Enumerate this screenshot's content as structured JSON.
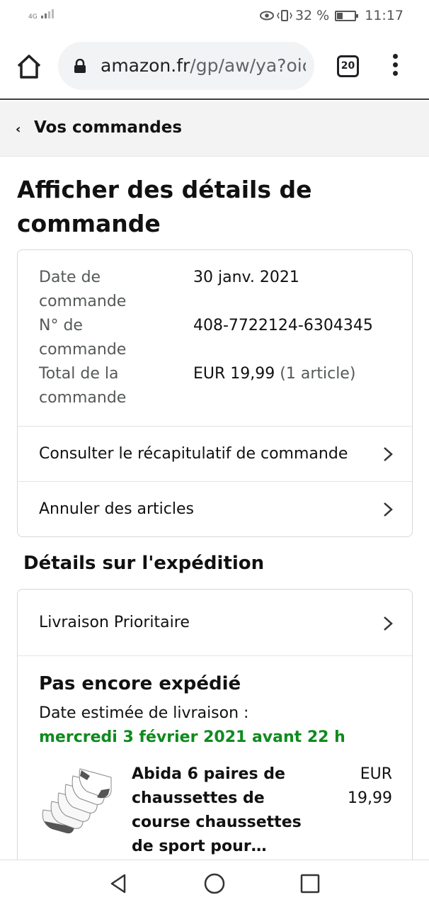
{
  "status_bar": {
    "network": "4G",
    "battery_percent": "32 %",
    "battery_level": 0.32,
    "time": "11:17"
  },
  "browser": {
    "url_host": "amazon.fr",
    "url_path": "/gp/aw/ya?oic",
    "tab_count": "20"
  },
  "breadcrumb": {
    "label": "Vos commandes"
  },
  "page_title": "Afficher des détails de commande",
  "order": {
    "date_label": "Date de commande",
    "date_value": "30 janv. 2021",
    "number_label": "N° de commande",
    "number_value": "408-7722124-6304345",
    "total_label": "Total de la commande",
    "total_value": "EUR 19,99",
    "total_items": "(1 article)",
    "summary_link": "Consulter le récapitulatif de commande",
    "cancel_link": "Annuler des articles"
  },
  "shipment": {
    "section_title": "Détails sur l'expédition",
    "delivery_type": "Livraison Prioritaire",
    "status": "Pas encore expédié",
    "estimate_label": "Date estimée de livraison :",
    "estimate_date": "mercredi 3 février 2021 avant 22 h",
    "product_title": "Abida 6 paires de chaussettes de course chaussettes de sport pour…",
    "price_currency": "EUR",
    "price_amount": "19,99"
  },
  "colors": {
    "delivery_green": "#0f8a1f",
    "muted_text": "#565959",
    "breadcrumb_bg": "#f3f3f3"
  }
}
